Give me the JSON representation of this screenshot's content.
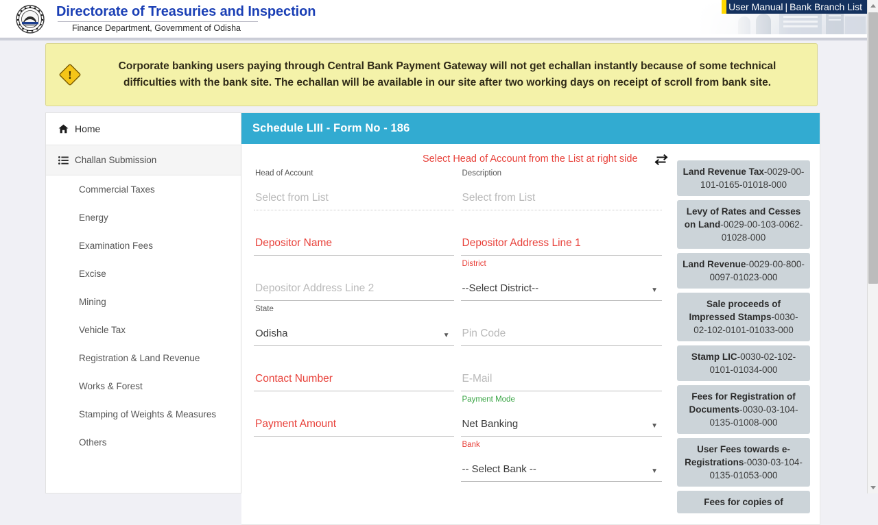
{
  "header": {
    "brand_title": "Directorate of Treasuries and Inspection",
    "brand_subtitle": "Finance Department, Government of Odisha",
    "top_links": {
      "user_manual": "User Manual",
      "separator": "|",
      "bank_branch_list": "Bank Branch List"
    }
  },
  "notice": {
    "text": "Corporate banking users paying through Central Bank Payment Gateway will not get echallan instantly because of some technical difficulties with the bank site. The echallan will be available in our site after two working days on receipt of scroll from bank site.",
    "background_color": "#f4f2a9",
    "icon": "warning-diamond-icon"
  },
  "sidebar": {
    "home_label": "Home",
    "section_label": "Challan Submission",
    "items": [
      {
        "label": "Commercial Taxes"
      },
      {
        "label": "Energy"
      },
      {
        "label": "Examination Fees"
      },
      {
        "label": "Excise"
      },
      {
        "label": "Mining"
      },
      {
        "label": "Vehicle Tax"
      },
      {
        "label": "Registration & Land Revenue"
      },
      {
        "label": "Works & Forest"
      },
      {
        "label": "Stamping of Weights & Measures"
      },
      {
        "label": "Others"
      }
    ]
  },
  "form": {
    "title": "Schedule LIII - Form No - 186",
    "title_bar_color": "#32abd1",
    "hint": "Select Head of Account from the List at right side",
    "swap_icon": "swap-horizontal-icon",
    "head_of_account": {
      "label": "Head of Account",
      "placeholder": "Select from List"
    },
    "description": {
      "label": "Description",
      "placeholder": "Select from List"
    },
    "depositor_name": {
      "label": "Depositor Name",
      "value": ""
    },
    "depositor_address_1": {
      "label": "Depositor Address Line 1",
      "value": ""
    },
    "depositor_address_2": {
      "placeholder": "Depositor Address Line 2",
      "value": ""
    },
    "district": {
      "label": "District",
      "value": "--Select District--"
    },
    "state": {
      "label": "State",
      "value": "Odisha"
    },
    "pin_code": {
      "placeholder": "Pin Code",
      "value": ""
    },
    "contact_number": {
      "label": "Contact Number",
      "value": ""
    },
    "email": {
      "placeholder": "E-Mail",
      "value": ""
    },
    "payment_amount": {
      "label": "Payment Amount",
      "value": ""
    },
    "payment_mode": {
      "label": "Payment Mode",
      "value": "Net Banking"
    },
    "bank": {
      "label": "Bank",
      "value": "-- Select Bank --"
    },
    "required_label_color": "#e8413a",
    "filled_label_color": "#39a544"
  },
  "account_list": [
    {
      "name": "Land Revenue Tax",
      "code": "-0029-00-101-0165-01018-000"
    },
    {
      "name": "Levy of Rates and Cesses on Land",
      "code": "-0029-00-103-0062-01028-000"
    },
    {
      "name": "Land Revenue",
      "code": "-0029-00-800-0097-01023-000"
    },
    {
      "name": "Sale proceeds of Impressed Stamps",
      "code": "-0030-02-102-0101-01033-000"
    },
    {
      "name": "Stamp LIC",
      "code": "-0030-02-102-0101-01034-000"
    },
    {
      "name": "Fees for Registration of Documents",
      "code": "-0030-03-104-0135-01008-000"
    },
    {
      "name": "User Fees towards e-Registrations",
      "code": "-0030-03-104-0135-01053-000"
    },
    {
      "name": "Fees for copies of",
      "code": ""
    }
  ]
}
